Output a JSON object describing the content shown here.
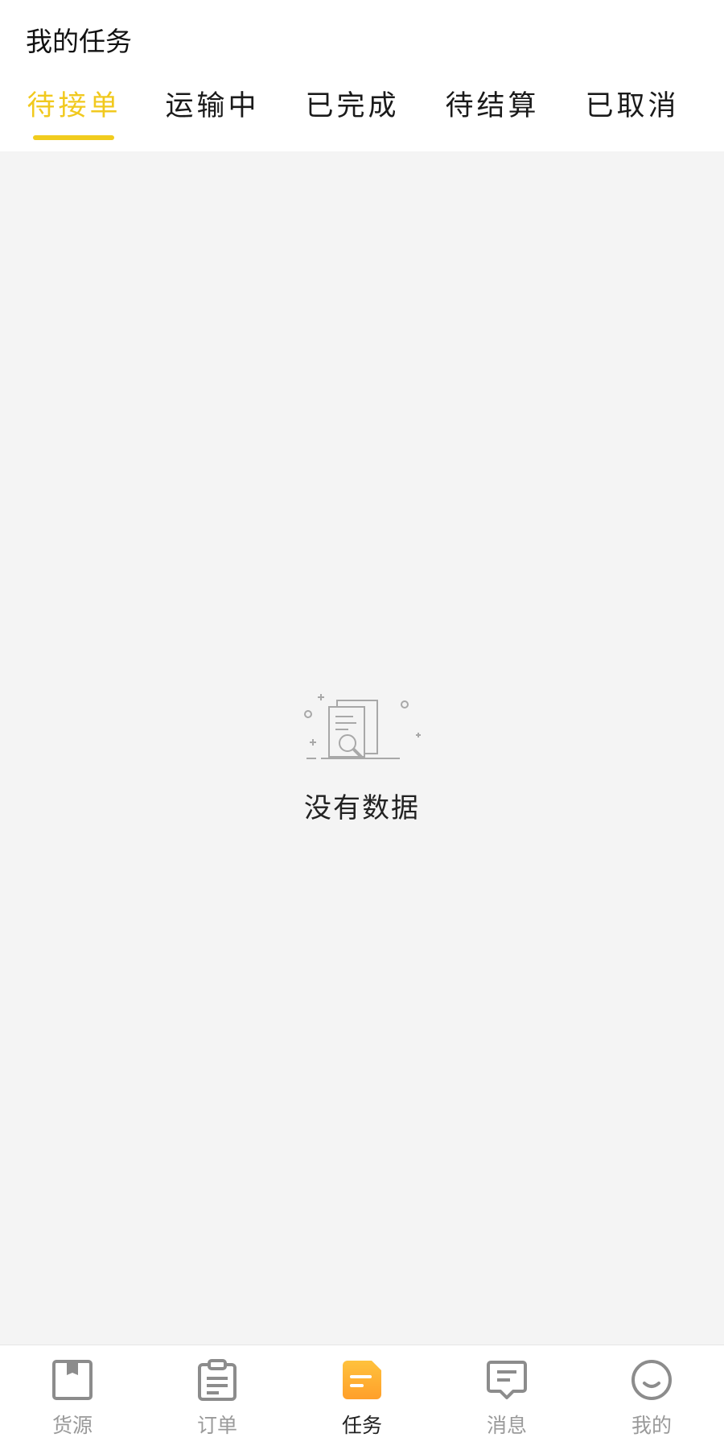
{
  "header": {
    "title": "我的任务"
  },
  "tabs": [
    {
      "label": "待接单",
      "active": true
    },
    {
      "label": "运输中",
      "active": false
    },
    {
      "label": "已完成",
      "active": false
    },
    {
      "label": "待结算",
      "active": false
    },
    {
      "label": "已取消",
      "active": false
    }
  ],
  "empty_state": {
    "icon": "empty-document-search-icon",
    "text": "没有数据"
  },
  "bottom_nav": [
    {
      "label": "货源",
      "icon": "cargo-box-icon",
      "active": false
    },
    {
      "label": "订单",
      "icon": "clipboard-icon",
      "active": false
    },
    {
      "label": "任务",
      "icon": "task-icon",
      "active": true
    },
    {
      "label": "消息",
      "icon": "message-icon",
      "active": false
    },
    {
      "label": "我的",
      "icon": "smiley-icon",
      "active": false
    }
  ],
  "colors": {
    "accent": "#f1c91e",
    "task_icon": "#ffb033",
    "background": "#f4f4f4"
  }
}
